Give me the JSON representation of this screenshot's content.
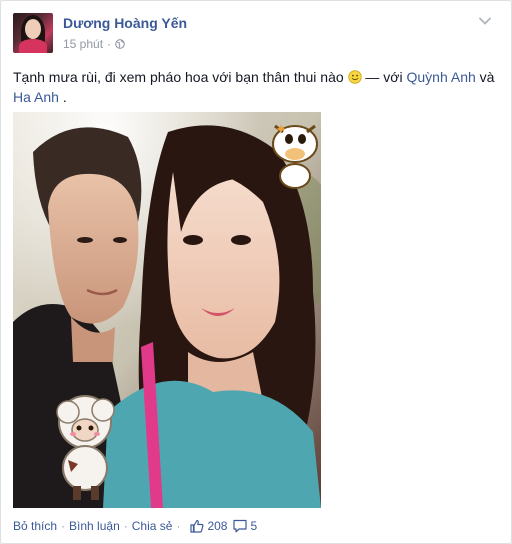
{
  "post": {
    "author": "Dương Hoàng Yến",
    "time": "15 phút",
    "privacy_icon": "globe-icon",
    "text_before": "Tạnh mưa rùi, đi xem pháo hoa với bạn thân thui nào",
    "emoji": "smiley-icon",
    "text_with": " — với ",
    "tag1": "Quỳnh Anh",
    "text_and": " và ",
    "tag2": "Ha Anh",
    "text_end": "."
  },
  "actions": {
    "like": "Bỏ thích",
    "comment": "Bình luận",
    "share": "Chia sẻ",
    "separator": "·",
    "like_count": "208",
    "comment_count": "5"
  },
  "colors": {
    "link": "#3b5998",
    "meta": "#9197a3",
    "text": "#141823"
  }
}
